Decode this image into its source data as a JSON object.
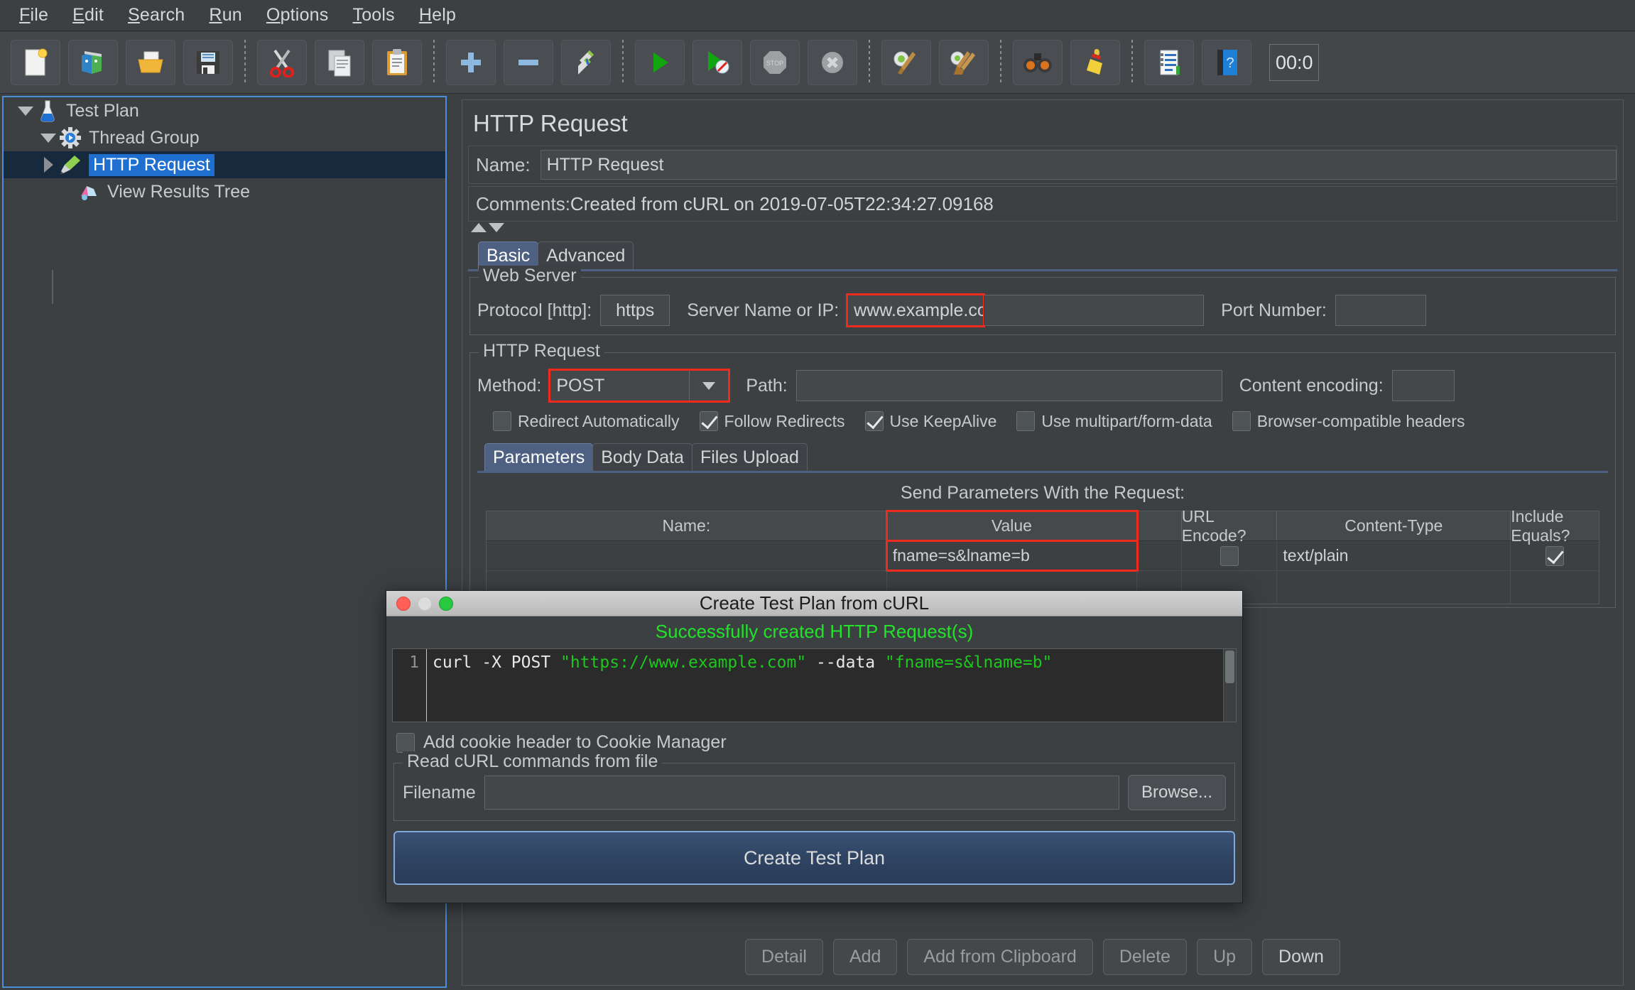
{
  "menubar": {
    "items": [
      {
        "label": "File",
        "mnemonic": "F"
      },
      {
        "label": "Edit",
        "mnemonic": "E"
      },
      {
        "label": "Search",
        "mnemonic": "S"
      },
      {
        "label": "Run",
        "mnemonic": "R"
      },
      {
        "label": "Options",
        "mnemonic": "O"
      },
      {
        "label": "Tools",
        "mnemonic": "T"
      },
      {
        "label": "Help",
        "mnemonic": "H"
      }
    ]
  },
  "toolbar": {
    "buttons": [
      {
        "icon": "new-document-icon",
        "tooltip": "New"
      },
      {
        "icon": "templates-icon",
        "tooltip": "Templates"
      },
      {
        "icon": "open-folder-icon",
        "tooltip": "Open"
      },
      {
        "icon": "save-floppy-icon",
        "tooltip": "Save"
      },
      {
        "icon": "cut-scissors-icon",
        "tooltip": "Cut"
      },
      {
        "icon": "copy-pages-icon",
        "tooltip": "Copy"
      },
      {
        "icon": "paste-clipboard-icon",
        "tooltip": "Paste"
      },
      {
        "icon": "plus-icon",
        "tooltip": "Expand All"
      },
      {
        "icon": "minus-icon",
        "tooltip": "Collapse All"
      },
      {
        "icon": "toggle-pencils-icon",
        "tooltip": "Toggle"
      },
      {
        "icon": "start-play-icon",
        "tooltip": "Start"
      },
      {
        "icon": "start-no-pauses-icon",
        "tooltip": "Start no pauses"
      },
      {
        "icon": "stop-icon",
        "tooltip": "Stop"
      },
      {
        "icon": "shutdown-icon",
        "tooltip": "Shutdown"
      },
      {
        "icon": "clear-broom-icon",
        "tooltip": "Clear"
      },
      {
        "icon": "clear-all-brooms-icon",
        "tooltip": "Clear All"
      },
      {
        "icon": "search-binoculars-icon",
        "tooltip": "Search"
      },
      {
        "icon": "reset-search-broom-icon",
        "tooltip": "Reset Search"
      },
      {
        "icon": "function-helper-icon",
        "tooltip": "Function Helper"
      },
      {
        "icon": "help-book-icon",
        "tooltip": "Help"
      }
    ],
    "timer": "00:0"
  },
  "tree": {
    "items": [
      {
        "label": "Test Plan",
        "icon": "flask-icon",
        "twisty": "down",
        "depth": 0,
        "selected": false
      },
      {
        "label": "Thread Group",
        "icon": "gear-icon",
        "twisty": "down",
        "depth": 1,
        "selected": false
      },
      {
        "label": "HTTP Request",
        "icon": "pipette-icon",
        "twisty": "right",
        "depth": 2,
        "selected": true
      },
      {
        "label": "View Results Tree",
        "icon": "results-tree-icon",
        "twisty": "none",
        "depth": 2,
        "selected": false
      }
    ]
  },
  "panel": {
    "title": "HTTP Request",
    "name_label": "Name:",
    "name_value": "HTTP Request",
    "comments_label": "Comments:",
    "comments_value": "Created from cURL on 2019-07-05T22:34:27.09168",
    "tabs": [
      {
        "label": "Basic",
        "active": true
      },
      {
        "label": "Advanced",
        "active": false
      }
    ],
    "web_server": {
      "legend": "Web Server",
      "protocol_label": "Protocol [http]:",
      "protocol_value": "https",
      "server_label": "Server Name or IP:",
      "server_value": "www.example.com",
      "port_label": "Port Number:",
      "port_value": ""
    },
    "http_request": {
      "legend": "HTTP Request",
      "method_label": "Method:",
      "method_value": "POST",
      "path_label": "Path:",
      "path_value": "",
      "content_encoding_label": "Content encoding:",
      "content_encoding_value": "",
      "checkboxes": [
        {
          "label": "Redirect Automatically",
          "checked": false
        },
        {
          "label": "Follow Redirects",
          "checked": true
        },
        {
          "label": "Use KeepAlive",
          "checked": true
        },
        {
          "label": "Use multipart/form-data",
          "checked": false
        },
        {
          "label": "Browser-compatible headers",
          "checked": false
        }
      ],
      "subtabs": [
        {
          "label": "Parameters",
          "active": true
        },
        {
          "label": "Body Data",
          "active": false
        },
        {
          "label": "Files Upload",
          "active": false
        }
      ],
      "params_header": "Send Parameters With the Request:",
      "params_columns": [
        "Name:",
        "Value",
        "URL Encode?",
        "Content-Type",
        "Include Equals?"
      ],
      "params_rows": [
        {
          "name": "",
          "value": "fname=s&lname=b",
          "url_encode": false,
          "content_type": "text/plain",
          "include_equals": true
        }
      ]
    },
    "bottom_buttons": [
      {
        "label": "Detail"
      },
      {
        "label": "Add"
      },
      {
        "label": "Add from Clipboard"
      },
      {
        "label": "Delete"
      },
      {
        "label": "Up"
      },
      {
        "label": "Down"
      }
    ]
  },
  "dialog": {
    "title": "Create Test Plan from cURL",
    "status_message": "Successfully created HTTP Request(s)",
    "status_color": "#22e32a",
    "editor": {
      "line_number": "1",
      "tokens": [
        {
          "text": "curl -X POST ",
          "type": "plain"
        },
        {
          "text": "\"https://www.example.com\"",
          "type": "string"
        },
        {
          "text": " --data ",
          "type": "plain"
        },
        {
          "text": "\"fname=s&lname=b\"",
          "type": "string"
        }
      ],
      "full_text": "curl -X POST \"https://www.example.com\" --data \"fname=s&lname=b\""
    },
    "cookie_checkbox": {
      "label": "Add cookie header to Cookie Manager",
      "checked": false
    },
    "file_group": {
      "legend": "Read cURL commands from file",
      "filename_label": "Filename",
      "filename_value": "",
      "browse_label": "Browse..."
    },
    "primary_button": "Create Test Plan"
  },
  "colors": {
    "accent_blue": "#4a90d9",
    "selection_blue": "#1f6fd0",
    "highlight_red": "#ef2b20",
    "success_green": "#22e32a",
    "panel_bg": "#3c4043"
  }
}
